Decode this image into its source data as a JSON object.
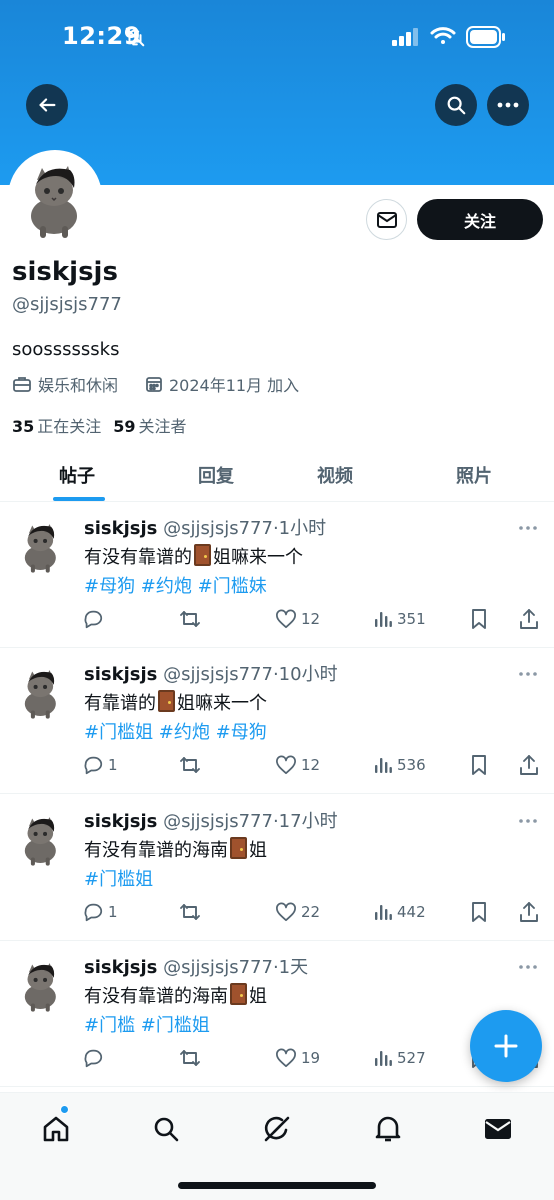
{
  "status": {
    "time": "12:29"
  },
  "profile": {
    "display_name": "siskjsjs",
    "handle": "@sjjsjsjs777",
    "bio": "soossssssks",
    "category": "娱乐和休闲",
    "joined": "2024年11月 加入",
    "following_count": "35",
    "following_label": "正在关注",
    "followers_count": "59",
    "followers_label": "关注者",
    "follow_button": "关注"
  },
  "tabs": [
    {
      "label": "帖子",
      "active": true
    },
    {
      "label": "回复",
      "active": false
    },
    {
      "label": "视频",
      "active": false
    },
    {
      "label": "照片",
      "active": false
    }
  ],
  "posts": [
    {
      "name": "siskjsjs",
      "handle": "@sjjsjsjs777",
      "time": "·1小时",
      "text_before": "有没有靠谱的",
      "text_after": "姐嘛来一个",
      "tags": "#母狗 #约炮 #门槛妹",
      "replies": "",
      "reposts": "",
      "likes": "12",
      "views": "351"
    },
    {
      "name": "siskjsjs",
      "handle": "@sjjsjsjs777",
      "time": "·10小时",
      "text_before": "有靠谱的",
      "text_after": "姐嘛来一个",
      "tags": "#门槛姐 #约炮 #母狗",
      "replies": "1",
      "reposts": "",
      "likes": "12",
      "views": "536"
    },
    {
      "name": "siskjsjs",
      "handle": "@sjjsjsjs777",
      "time": "·17小时",
      "text_before": "有没有靠谱的海南",
      "text_after": "姐",
      "tags": "#门槛姐",
      "replies": "1",
      "reposts": "",
      "likes": "22",
      "views": "442"
    },
    {
      "name": "siskjsjs",
      "handle": "@sjjsjsjs777",
      "time": "·1天",
      "text_before": "有没有靠谱的海南",
      "text_after": "姐",
      "tags": "#门槛 #门槛姐",
      "replies": "",
      "reposts": "",
      "likes": "19",
      "views": "527"
    }
  ],
  "colors": {
    "accent": "#1d9bf0",
    "text": "#0f1419",
    "muted": "#536471"
  },
  "icons": {
    "back": "arrow-left-icon",
    "search": "search-icon",
    "more": "more-icon",
    "message": "envelope-icon",
    "category": "briefcase-icon",
    "calendar": "calendar-icon",
    "reply": "reply-icon",
    "repost": "repost-icon",
    "like": "heart-icon",
    "views": "views-icon",
    "bookmark": "bookmark-icon",
    "share": "share-icon",
    "compose": "plus-icon",
    "home": "home-icon",
    "explore": "search-icon",
    "grok": "grok-icon",
    "notifications": "bell-icon",
    "messages": "envelope-icon"
  }
}
